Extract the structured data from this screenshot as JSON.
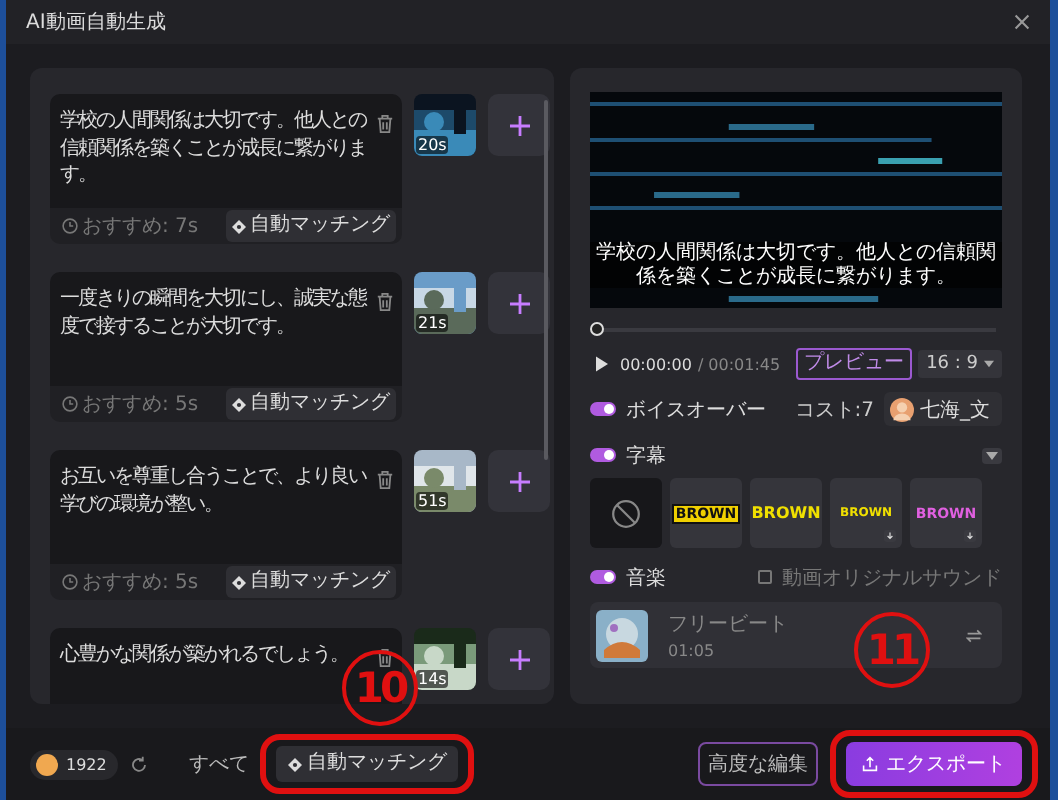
{
  "window": {
    "title": "AI動画自動生成"
  },
  "scenes": [
    {
      "text": "学校の人間関係は大切です。他人との信頼関係を築くことが成長に繋がります。",
      "duration": "20s",
      "recommend": "おすすめ: 7s",
      "match_button": "自動マッチング"
    },
    {
      "text": "一度きりの瞬間を大切にし、誠実な態度で接することが大切です。",
      "duration": "21s",
      "recommend": "おすすめ: 5s",
      "match_button": "自動マッチング"
    },
    {
      "text": "お互いを尊重し合うことで、より良い学びの環境が整い。",
      "duration": "51s",
      "recommend": "おすすめ: 5s",
      "match_button": "自動マッチング"
    },
    {
      "text": "心豊かな関係が築かれるでしょう。",
      "duration": "14s"
    }
  ],
  "preview": {
    "subtitle": "学校の人間関係は大切です。他人との信頼関係を築くことが成長に繋がります。",
    "level": 0,
    "time": "00:00:00",
    "total": "/ 00:01:45",
    "preview_button": "プレビュー",
    "aspect": "16 : 9"
  },
  "voiceover": {
    "label": "ボイスオーバー",
    "on": true,
    "cost": "コスト:7",
    "voice": "七海_文"
  },
  "subtitles": {
    "label": "字幕",
    "on": true,
    "styles": [
      {
        "kind": "none",
        "selected": true
      },
      {
        "kind": "boxed",
        "sample": "BROWN",
        "download": false,
        "selected": false
      },
      {
        "kind": "plain",
        "sample": "BROWN",
        "download": false,
        "selected": false
      },
      {
        "kind": "small",
        "sample": "BROWN",
        "download": true,
        "selected": false
      },
      {
        "kind": "gradient",
        "sample": "BROWN",
        "download": true,
        "selected": false
      }
    ]
  },
  "music": {
    "label": "音楽",
    "on": true,
    "original_sound": {
      "label": "動画オリジナルサウンド",
      "checked": false
    },
    "track": {
      "title": "フリービート",
      "duration": "01:05"
    }
  },
  "footer": {
    "coins": "1922",
    "all_label": "すべて",
    "match_all": "自動マッチング",
    "advanced_edit": "高度な編集",
    "export": "エクスポート"
  },
  "annotations": [
    {
      "label": "10"
    },
    {
      "label": "11"
    }
  ]
}
